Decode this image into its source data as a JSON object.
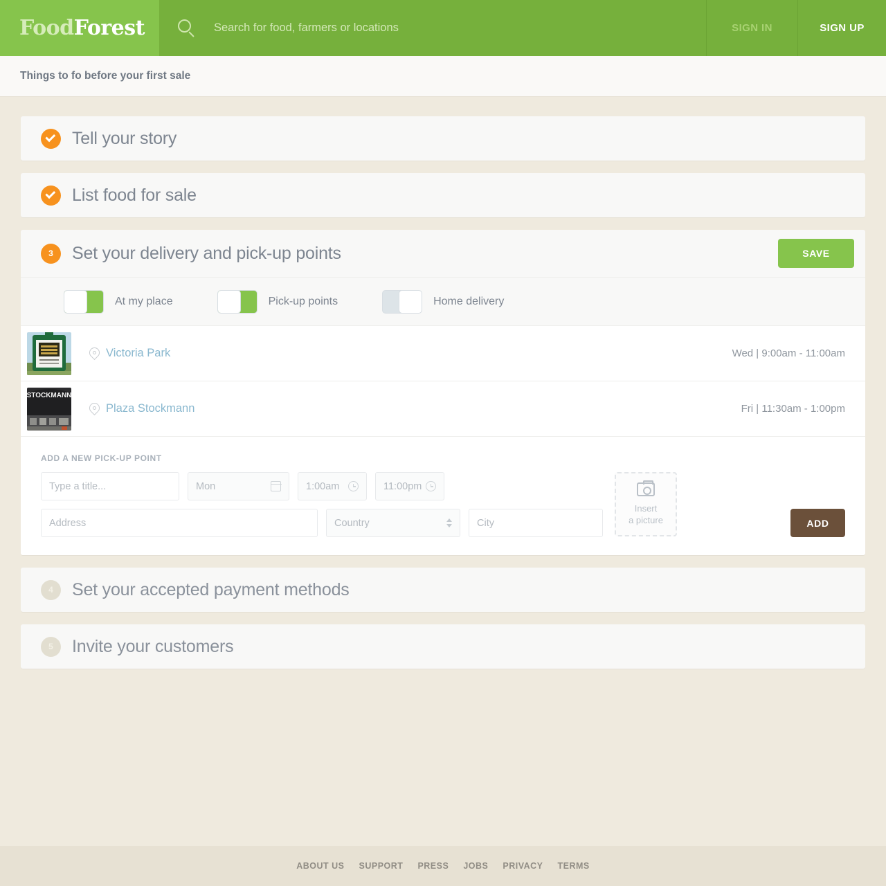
{
  "header": {
    "logo_part1": "Food",
    "logo_part2": "Forest",
    "search_placeholder": "Search for food, farmers or locations",
    "search_value": "",
    "sign_in": "SIGN IN",
    "sign_up": "SIGN UP",
    "colors": {
      "logo_green": "#86c44c",
      "bar_green": "#76b03c"
    }
  },
  "subheader": {
    "title": "Things to fo before your first sale"
  },
  "steps": [
    {
      "badge": "check",
      "number": "",
      "title": "Tell your story",
      "state": "done"
    },
    {
      "badge": "check",
      "number": "",
      "title": "List food for sale",
      "state": "done"
    },
    {
      "badge": "number",
      "number": "3",
      "title": "Set your delivery and pick-up points",
      "state": "active"
    },
    {
      "badge": "number",
      "number": "4",
      "title": "Set your accepted payment methods",
      "state": "todo"
    },
    {
      "badge": "number",
      "number": "5",
      "title": "Invite your customers",
      "state": "todo"
    }
  ],
  "step3": {
    "save_label": "SAVE",
    "toggles": [
      {
        "label": "At my place",
        "state": "on"
      },
      {
        "label": "Pick-up points",
        "state": "on"
      },
      {
        "label": "Home delivery",
        "state": "off"
      }
    ],
    "pickup_points": [
      {
        "name": "Victoria Park",
        "schedule": "Wed | 9:00am - 11:00am",
        "thumb": "victoria-park-sign"
      },
      {
        "name": "Plaza Stockmann",
        "schedule": "Fri | 11:30am - 1:00pm",
        "thumb": "stockmann-building"
      }
    ],
    "add_form": {
      "section_title": "ADD A NEW PICK-UP POINT",
      "title_placeholder": "Type a title...",
      "title_value": "",
      "day_value": "Mon",
      "time_from_value": "1:00am",
      "time_to_value": "11:00pm",
      "address_placeholder": "Address",
      "address_value": "",
      "country_value": "Country",
      "city_placeholder": "City",
      "city_value": "",
      "picture_line1": "Insert",
      "picture_line2": "a picture",
      "add_label": "ADD"
    }
  },
  "footer": {
    "links": [
      "ABOUT US",
      "SUPPORT",
      "PRESS",
      "JOBS",
      "PRIVACY",
      "TERMS"
    ]
  }
}
